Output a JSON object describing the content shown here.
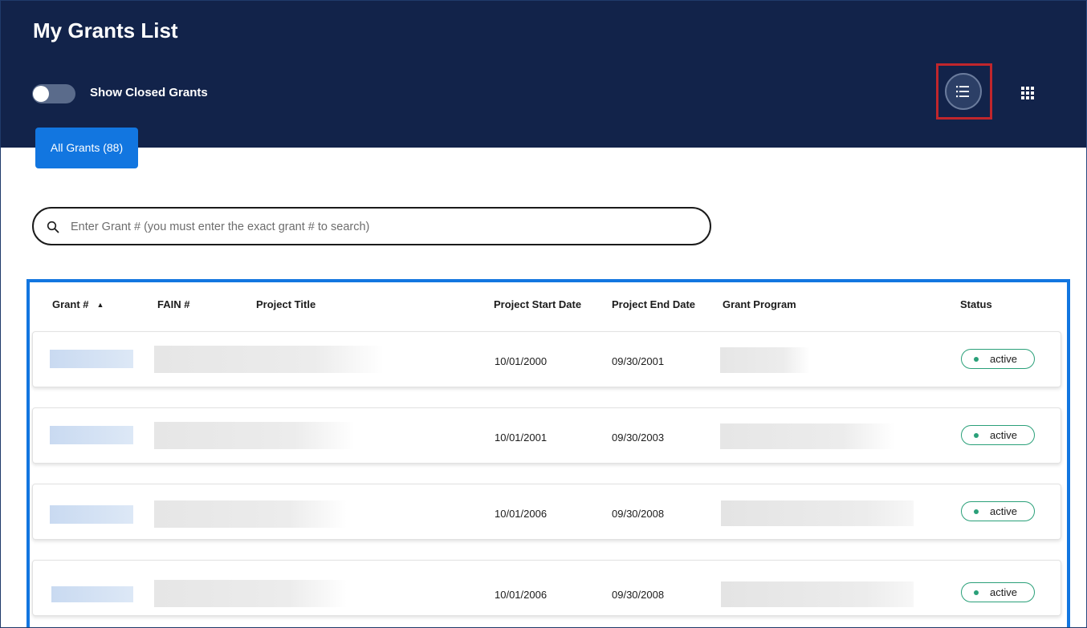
{
  "page": {
    "title": "My Grants List"
  },
  "toolbar": {
    "toggle_label": "Show Closed Grants",
    "list_view_icon": "list-view-icon",
    "grid_view_icon": "grid-view-icon"
  },
  "tabs": [
    {
      "label": "All Grants (88)"
    }
  ],
  "search": {
    "placeholder": "Enter Grant # (you must enter the exact grant # to search)",
    "icon": "search-icon"
  },
  "table": {
    "columns": [
      "Grant #",
      "FAIN #",
      "Project Title",
      "Project Start Date",
      "Project End Date",
      "Grant Program",
      "Status"
    ],
    "sort_icon": "sort-ascending-icon",
    "rows": [
      {
        "start": "10/01/2000",
        "end": "09/30/2001",
        "status": "active"
      },
      {
        "start": "10/01/2001",
        "end": "09/30/2003",
        "status": "active"
      },
      {
        "start": "10/01/2006",
        "end": "09/30/2008",
        "status": "active"
      },
      {
        "start": "10/01/2006",
        "end": "09/30/2008",
        "status": "active"
      }
    ]
  },
  "colors": {
    "header_bg": "#12234a",
    "accent": "#1276e0",
    "status_active": "#2aa079",
    "highlight": "#c0262c"
  }
}
